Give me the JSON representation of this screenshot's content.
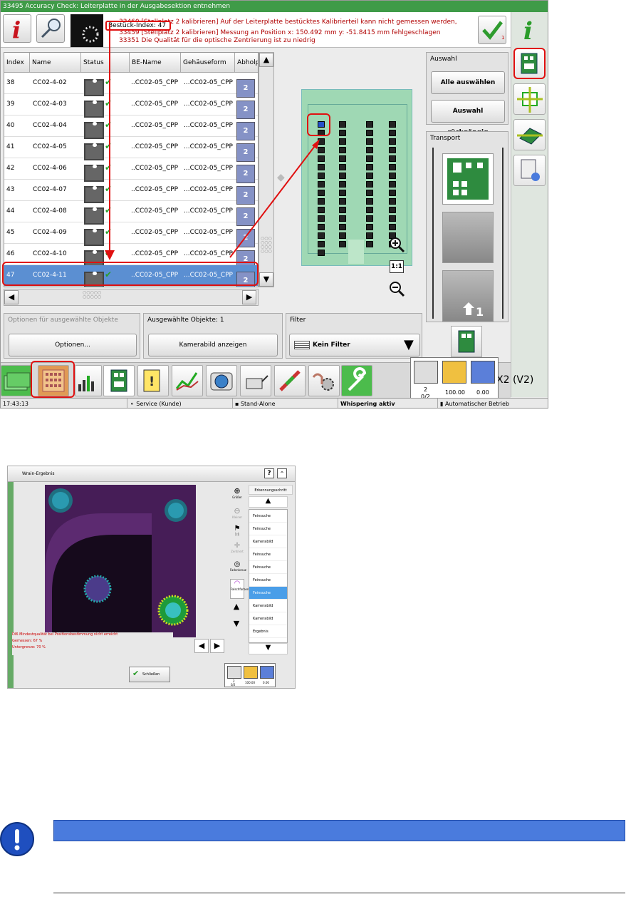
{
  "shot1": {
    "window_title": "33495 Accuracy Check: Leiterplatte in der Ausgabesektion entnehmen",
    "messages": {
      "annotation": "Bestück-Index: 47",
      "line1": "33460 [Stellplatz 2 kalibrieren] Auf der Leiterplatte bestücktes Kalibrierteil kann nicht gemessen werden,",
      "line2": "33459 [Stellplatz 2 kalibrieren] Messung an Position x: 150.492 mm y: -51.8415 mm fehlgeschlagen",
      "line3": "33351 Die Qualität für die optische Zentrierung ist zu niedrig",
      "ok_badge": "1"
    },
    "table": {
      "headers": [
        "Index",
        "Name",
        "Status",
        "BE-Name",
        "Gehäuseform",
        "Abholpl"
      ],
      "rows": [
        {
          "index": "38",
          "name": "CC02-4-02",
          "be": "..CC02-05_CPP",
          "gf": "...CC02-05_CPP",
          "pos": "2"
        },
        {
          "index": "39",
          "name": "CC02-4-03",
          "be": "..CC02-05_CPP",
          "gf": "...CC02-05_CPP",
          "pos": "2"
        },
        {
          "index": "40",
          "name": "CC02-4-04",
          "be": "..CC02-05_CPP",
          "gf": "...CC02-05_CPP",
          "pos": "2"
        },
        {
          "index": "41",
          "name": "CC02-4-05",
          "be": "..CC02-05_CPP",
          "gf": "...CC02-05_CPP",
          "pos": "2"
        },
        {
          "index": "42",
          "name": "CC02-4-06",
          "be": "..CC02-05_CPP",
          "gf": "...CC02-05_CPP",
          "pos": "2"
        },
        {
          "index": "43",
          "name": "CC02-4-07",
          "be": "..CC02-05_CPP",
          "gf": "...CC02-05_CPP",
          "pos": "2"
        },
        {
          "index": "44",
          "name": "CC02-4-08",
          "be": "..CC02-05_CPP",
          "gf": "...CC02-05_CPP",
          "pos": "2"
        },
        {
          "index": "45",
          "name": "CC02-4-09",
          "be": "..CC02-05_CPP",
          "gf": "...CC02-05_CPP",
          "pos": "2"
        },
        {
          "index": "46",
          "name": "CC02-4-10",
          "be": "..CC02-05_CPP",
          "gf": "...CC02-05_CPP",
          "pos": "2"
        },
        {
          "index": "47",
          "name": "CC02-4-11",
          "be": "..CC02-05_CPP",
          "gf": "...CC02-05_CPP",
          "pos": "2"
        }
      ]
    },
    "auswahl": {
      "title": "Auswahl",
      "select_all": "Alle auswählen",
      "undo": "Auswahl rückgängig"
    },
    "transport": {
      "title": "Transport"
    },
    "zoom_1to1": "1:1",
    "options": {
      "title": "Optionen für ausgewählte Objekte",
      "button": "Optionen..."
    },
    "selected": {
      "title": "Ausgewählte Objekte: 1",
      "button": "Kamerabild anzeigen"
    },
    "filter": {
      "title": "Filter",
      "value": "Kein Filter"
    },
    "machine_suffix": "X2 (V2)",
    "counters": {
      "c1": "2",
      "c1b": "0/2",
      "c2": "100.00",
      "c3": "0.00"
    },
    "status": {
      "time": "17:43:13",
      "service": "Service (Kunde)",
      "mode": "Stand-Alone",
      "whisper": "Whispering aktiv",
      "auto": "Automatischer Betrieb"
    }
  },
  "shot2": {
    "window_title": "Wrain-Ergebnis",
    "help": "?",
    "list_header": "Erkennungsschritt",
    "list_items": [
      "Feinsuche",
      "Feinsuche",
      "Kamerabild",
      "Feinsuche",
      "Feinsuche",
      "Feinsuche",
      "Feinsuche",
      "Kamerabild",
      "Kamerabild",
      "Ergebnis"
    ],
    "tools": {
      "zoom_in": "Größer",
      "zoom_out": "Kleiner",
      "one_to_one": "1:1",
      "crosshair": "Zentriert",
      "ring": "Fadenkreuz",
      "false_color": "Falschfarben"
    },
    "error_line1": "DI6  Mindestqualität bei Positionsbestimmung nicht erreicht",
    "error_line2": "Gemessen: 67 %",
    "error_line3": "Untergrenze: 70 %",
    "close_button": "Schließen",
    "counters": {
      "c1": "2",
      "c1b": "0/2",
      "c2": "100.00",
      "c3": "0.00"
    }
  }
}
